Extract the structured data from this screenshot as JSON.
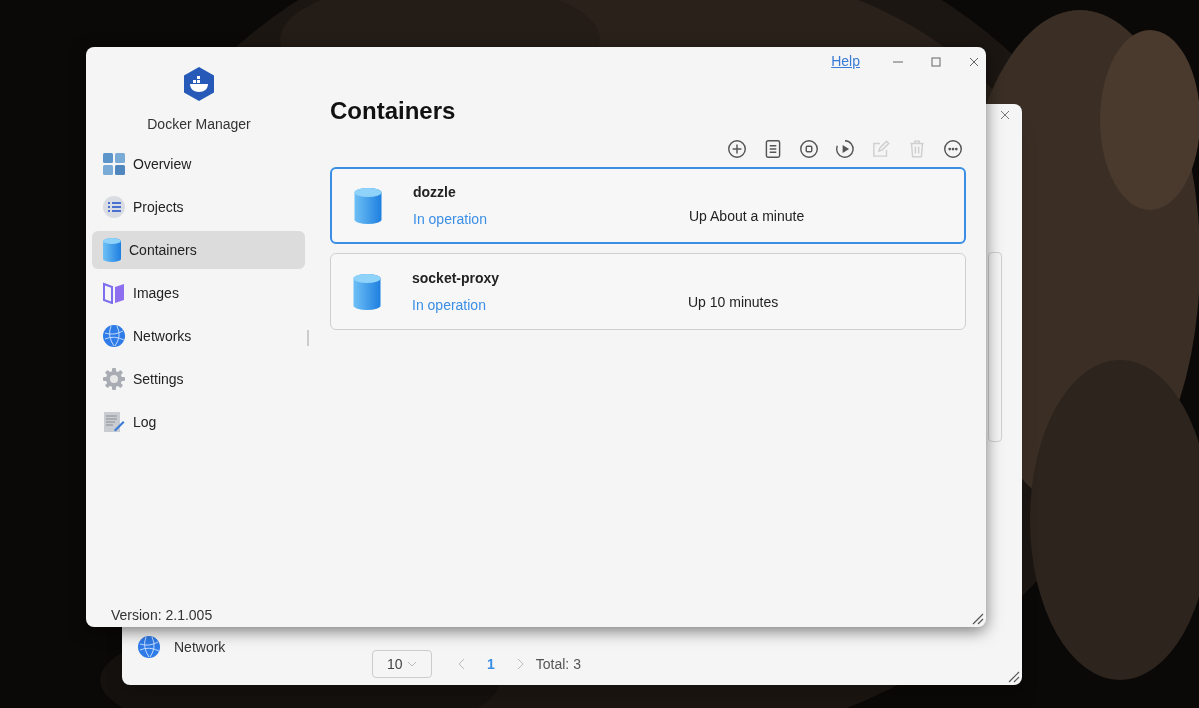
{
  "background_window": {
    "sidebar_item": {
      "label": "Network",
      "kind": "networks"
    },
    "pagination": {
      "page_size": "10",
      "pages": [
        {
          "label": "1",
          "selected": true
        }
      ],
      "total": "Total: 3"
    }
  },
  "window": {
    "help_link": "Help",
    "app_name": "Docker Manager",
    "sidebar": {
      "items": [
        {
          "label": "Overview",
          "kind": "overview",
          "selected": false
        },
        {
          "label": "Projects",
          "kind": "projects",
          "selected": false
        },
        {
          "label": "Containers",
          "kind": "containers",
          "selected": true
        },
        {
          "label": "Images",
          "kind": "images",
          "selected": false
        },
        {
          "label": "Networks",
          "kind": "networks",
          "selected": false
        },
        {
          "label": "Settings",
          "kind": "settings",
          "selected": false
        },
        {
          "label": "Log",
          "kind": "log",
          "selected": false
        }
      ]
    },
    "version": "Version: 2.1.005",
    "page_title": "Containers",
    "toolbar": [
      {
        "kind": "add",
        "disabled": false
      },
      {
        "kind": "logs",
        "disabled": false
      },
      {
        "kind": "stop",
        "disabled": false
      },
      {
        "kind": "restart",
        "disabled": false
      },
      {
        "kind": "edit",
        "disabled": true
      },
      {
        "kind": "delete",
        "disabled": true
      },
      {
        "kind": "more",
        "disabled": false
      }
    ],
    "containers": [
      {
        "name": "dozzle",
        "status": "In operation",
        "uptime": "Up About a minute",
        "selected": true
      },
      {
        "name": "socket-proxy",
        "status": "In operation",
        "uptime": "Up 10 minutes",
        "selected": false
      }
    ]
  }
}
